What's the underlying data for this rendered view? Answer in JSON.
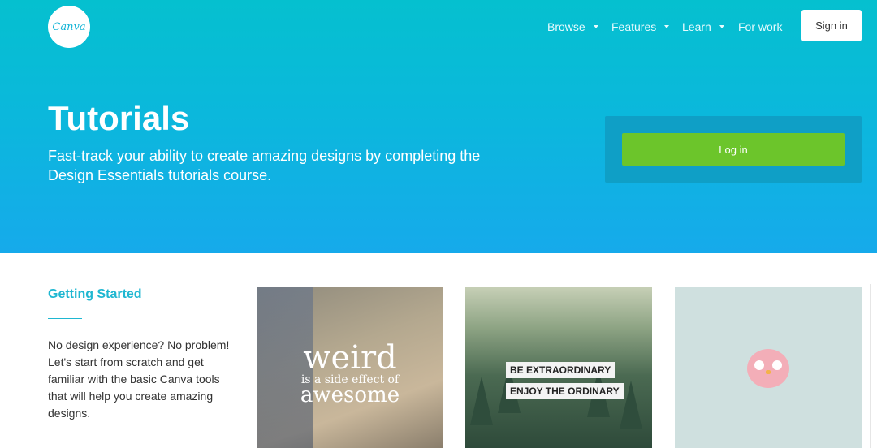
{
  "header": {
    "logo_text": "Canva",
    "nav": [
      {
        "label": "Browse",
        "has_caret": true
      },
      {
        "label": "Features",
        "has_caret": true
      },
      {
        "label": "Learn",
        "has_caret": true
      },
      {
        "label": "For work",
        "has_caret": false
      }
    ],
    "signin_label": "Sign in"
  },
  "hero": {
    "title": "Tutorials",
    "subtitle": "Fast-track your ability to create amazing designs by completing the Design Essentials tutorials course.",
    "login_label": "Log in"
  },
  "section": {
    "title": "Getting Started",
    "description": "No design experience? No problem! Let's start from scratch and get familiar with the basic Canva tools that will help you create amazing designs."
  },
  "cards": [
    {
      "lines": [
        "weird",
        "is a side effect of",
        "awesome"
      ]
    },
    {
      "lines": [
        "BE EXTRAORDINARY",
        "ENJOY THE ORDINARY"
      ]
    },
    {
      "lines": []
    }
  ],
  "colors": {
    "hero_top": "#05c0cf",
    "hero_bottom": "#16aaeb",
    "accent": "#1fb7d1",
    "login_button": "#6cc52b"
  }
}
